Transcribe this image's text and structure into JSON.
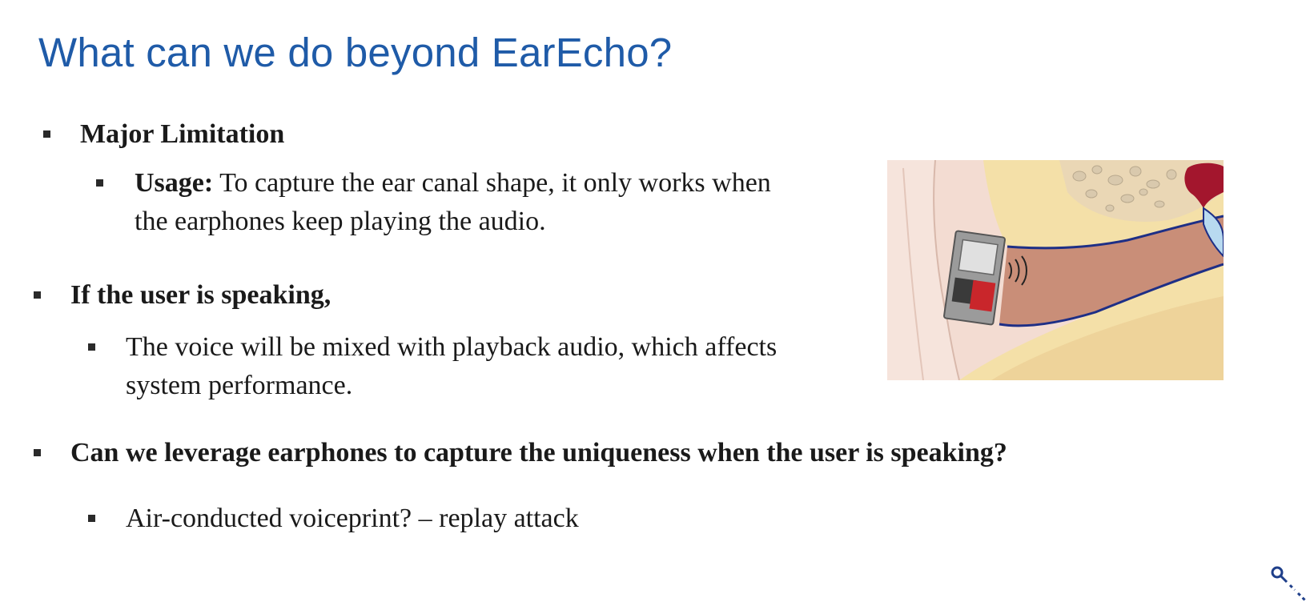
{
  "slide": {
    "title": "What can we do beyond EarEcho?",
    "items": [
      {
        "id": "major-limitation",
        "text": "Major Limitation"
      },
      {
        "id": "usage-label",
        "text": "Usage:"
      },
      {
        "id": "usage-line1",
        "text": " To capture the ear canal shape, it only works when"
      },
      {
        "id": "usage-line2",
        "text": "the earphones keep playing the audio."
      },
      {
        "id": "if-speaking",
        "text": "If the user is speaking,"
      },
      {
        "id": "voice-line1",
        "text": "The voice will be mixed with playback audio, which affects"
      },
      {
        "id": "voice-line2",
        "text": "system performance."
      },
      {
        "id": "leverage-question",
        "text": "Can we leverage earphones to capture the uniqueness when the user is speaking?"
      },
      {
        "id": "air-conducted",
        "text": "Air-conducted voiceprint?  – replay attack"
      }
    ]
  },
  "figure": {
    "icon": "ear-canal-earphone-illustration",
    "colors": {
      "skin": "#f3dcd2",
      "bone": "#f4e0a8",
      "canal": "#c98e78",
      "canal_outline": "#1e2f86",
      "eardrum": "#b8daf0",
      "earphone_speaker": "#c9262b",
      "bone_texture": "#d9c9ad",
      "ossicle": "#a3162d"
    }
  },
  "overlay": {
    "icon": "magnifier-cursor-icon"
  }
}
